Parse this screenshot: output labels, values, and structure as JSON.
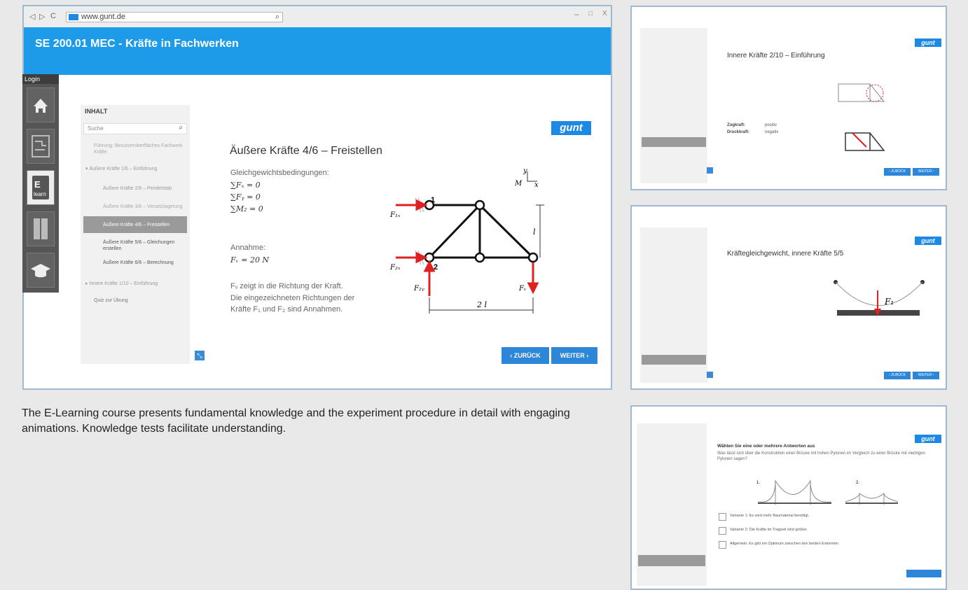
{
  "browser": {
    "url": "www.gunt.de",
    "nav_back": "◁",
    "nav_forward": "▷",
    "nav_reload": "C",
    "minimize": "–",
    "maximize": "□",
    "close": "X"
  },
  "app": {
    "title": "SE 200.01 MEC - Kräfte in Fachwerken",
    "login": "Login"
  },
  "toc": {
    "heading": "INHALT",
    "search_placeholder": "Suche",
    "items": [
      "Führung: Benutzeroberfläches Fachwerk Kräfte",
      "▾ Äußere Kräfte 1/6 – Einführung",
      "Äußere Kräfte 2/6 – Pendelstab",
      "Äußere Kräfte 3/6 – Versetzlagerung",
      "Äußere Kräfte 4/6 – Freistellen",
      "Äußere Kräfte 5/6 – Gleichungen erstellen",
      "Äußere Kräfte 6/6 – Berechnung",
      "▸ Innere Kräfte 1/10 – Einführung",
      "Quiz zur Übung"
    ]
  },
  "slide": {
    "logo": "gunt",
    "title": "Äußere Kräfte 4/6 – Freistellen",
    "equilibrium_heading": "Gleichgewichtsbedingungen:",
    "eq1": "∑Fₓ = 0",
    "eq2": "∑Fᵧ = 0",
    "eq3": "∑M₂ = 0",
    "assumption_heading": "Annahme:",
    "assumption_eq": "Fᵥ = 20 N",
    "note_line1": "Fᵥ zeigt in die Richtung der Kraft.",
    "note_line2": "Die eingezeichneten Richtungen der",
    "note_line3": "Kräfte F₁ und F₂ sind Annahmen.",
    "back_button": "‹ ZURÜCK",
    "next_button": "WEITER ›",
    "diagram": {
      "node1": "1",
      "node2": "2",
      "dim_h": "l",
      "dim_w": "2 l",
      "f1": "F₁ₓ",
      "f2": "F₂ₓ",
      "f2y": "F₂ᵧ",
      "fv": "Fᵥ",
      "axis_y": "y",
      "axis_x": "x",
      "axis_m": "M"
    }
  },
  "caption": "The E-Learning course presents fundamental knowledge and the experiment procedure in detail with engaging animations. Knowledge tests facilitate understanding.",
  "thumbnails": [
    {
      "title": "Innere Kräfte 2/10 – Einführung",
      "logo": "gunt",
      "back": "‹ ZURÜCK",
      "next": "WEITER ›",
      "label_a": "Zugkraft:",
      "value_a": "positiv",
      "label_b": "Druckkraft:",
      "value_b": "negativ"
    },
    {
      "title": "Kräftegleichgewicht, innere Kräfte 5/5",
      "logo": "gunt",
      "back": "‹ ZURÜCK",
      "next": "WEITER ›",
      "force": "F₁"
    },
    {
      "title": "Wählen Sie eine oder mehrere Antworten aus",
      "logo": "gunt",
      "question": "Was lässt sich über die Konstruktion einer Brücke mit hohen Pylonen im Vergleich zu einer Brücke mit niedrigen Pylonen sagen?",
      "opt1": "Variante 1: Es wird mehr Baumaterial benötigt.",
      "opt2": "Variante 2: Die Kräfte im Tragseil sind größer.",
      "opt3": "Allgemein: Es gibt ein Optimum zwischen den beiden Extremen.",
      "bridge1": "1.",
      "bridge2": "2."
    }
  ],
  "colors": {
    "accent": "#1e9be8",
    "button": "#2d86d8",
    "force": "#e02020"
  }
}
